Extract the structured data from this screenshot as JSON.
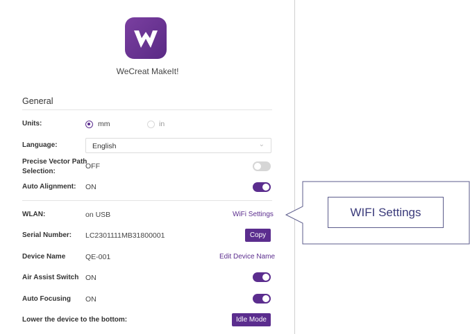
{
  "app": {
    "name": "WeCreat MakeIt!"
  },
  "general": {
    "title": "General",
    "units": {
      "label": "Units:",
      "options": [
        "mm",
        "in"
      ],
      "selected": "mm"
    },
    "language": {
      "label": "Language:",
      "value": "English"
    },
    "precise": {
      "label_line1": "Precise Vector Path",
      "label_line2": "Selection:",
      "value": "OFF",
      "toggle": "off"
    },
    "auto_align": {
      "label": "Auto Alignment:",
      "value": "ON",
      "toggle": "on"
    }
  },
  "device": {
    "wlan": {
      "label": "WLAN:",
      "value": "on USB",
      "link": "WiFi Settings"
    },
    "serial": {
      "label": "Serial Number:",
      "value": "LC2301111MB31800001",
      "button": "Copy"
    },
    "name": {
      "label": "Device Name",
      "value": "QE-001",
      "link": "Edit Device Name"
    },
    "air_assist": {
      "label": "Air Assist Switch",
      "value": "ON",
      "toggle": "on"
    },
    "auto_focus": {
      "label": "Auto Focusing",
      "value": "ON",
      "toggle": "on"
    },
    "lower": {
      "label": "Lower the device to the bottom:",
      "button": "Idle Mode"
    }
  },
  "callout": {
    "text": "WIFI Settings"
  },
  "colors": {
    "accent": "#5b2d8e",
    "callout_border": "#5b5b8b"
  }
}
